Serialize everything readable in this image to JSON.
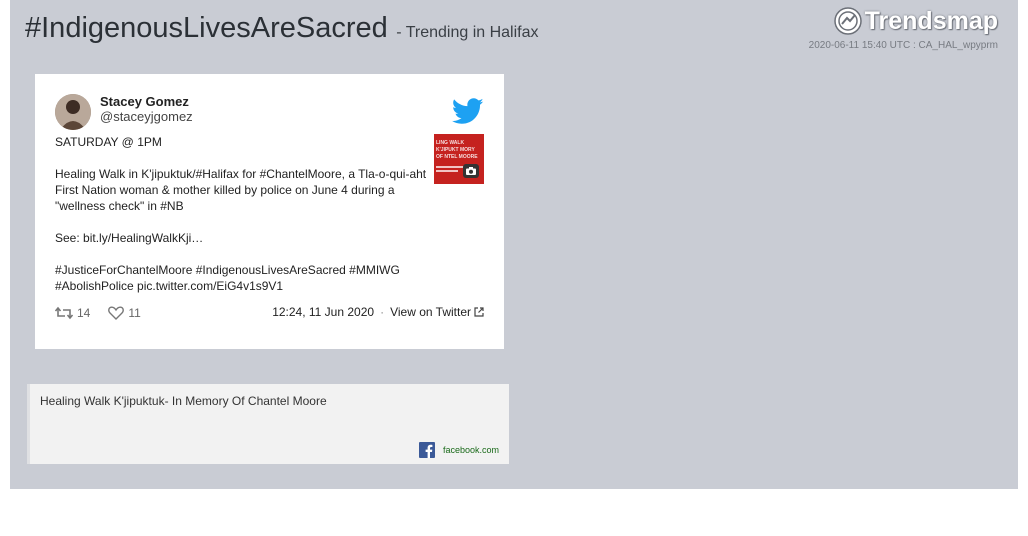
{
  "header": {
    "hashtag": "#IndigenousLivesAreSacred",
    "trend_sub": "- Trending in Halifax",
    "logo_text": "Trendsmap",
    "timestamp": "2020-06-11 15:40 UTC : CA_HAL_wpyprm"
  },
  "tweet": {
    "author_name": "Stacey Gomez",
    "author_handle": "@staceyjgomez",
    "lines": [
      "SATURDAY @ 1PM",
      "Healing Walk in K'jipuktuk/#Halifax for #ChantelMoore, a Tla-o-qui-aht First Nation woman & mother killed by police on June 4 during a \"wellness check\" in #NB",
      "See: bit.ly/HealingWalkKji…",
      "#JusticeForChantelMoore #IndigenousLivesAreSacred #MMIWG #AbolishPolice pic.twitter.com/EiG4v1s9V1"
    ],
    "retweets": "14",
    "likes": "11",
    "datetime": "12:24, 11 Jun 2020",
    "separator": "·",
    "view_link": "View on Twitter",
    "thumb_text": "LING WALK K'JIPUKT MORY OF NTEL MOORE"
  },
  "link_card": {
    "title": "Healing Walk K'jipuktuk- In Memory Of Chantel Moore",
    "domain": "facebook.com"
  },
  "colors": {
    "panel_bg": "#c9ccd4",
    "twitter_blue": "#1da1f2",
    "facebook_blue": "#3b5998",
    "thumb_red": "#c5221f"
  }
}
